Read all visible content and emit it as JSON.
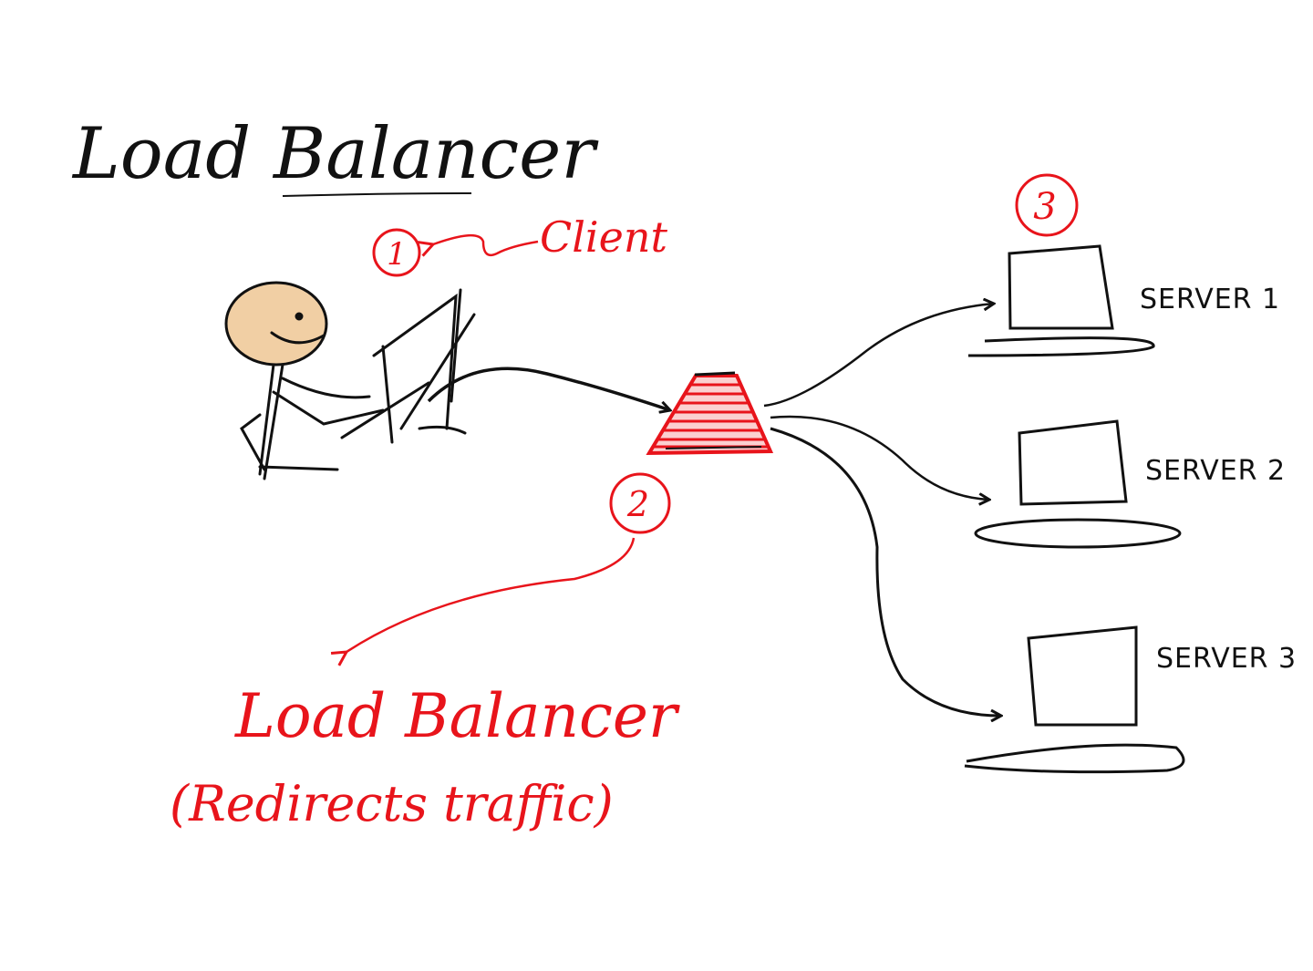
{
  "title": "Load Balancer",
  "client": {
    "label": "Client",
    "step": "1"
  },
  "load_balancer": {
    "step": "2",
    "label": "Load Balancer",
    "description": "(Redirects traffic)"
  },
  "servers": {
    "step": "3",
    "items": [
      {
        "label": "SERVER 1"
      },
      {
        "label": "SERVER 2"
      },
      {
        "label": "SERVER 3"
      }
    ]
  },
  "colors": {
    "ink": "#111111",
    "accent": "#e8141b",
    "face": "#f1cfa4"
  }
}
